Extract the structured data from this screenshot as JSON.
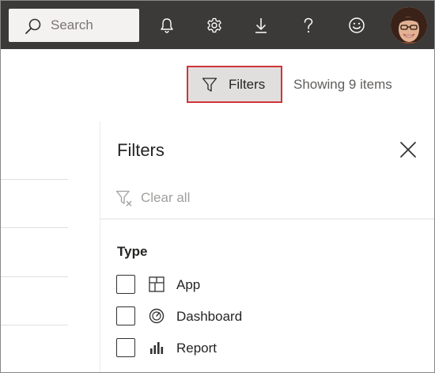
{
  "topbar": {
    "search": {
      "placeholder": "Search",
      "icon": "search-icon"
    },
    "actions": [
      {
        "name": "notifications",
        "icon": "bell-icon"
      },
      {
        "name": "settings",
        "icon": "gear-icon"
      },
      {
        "name": "download",
        "icon": "download-icon"
      },
      {
        "name": "help",
        "icon": "help-icon"
      },
      {
        "name": "feedback",
        "icon": "smiley-icon"
      }
    ],
    "avatar": {
      "icon": "user-avatar"
    },
    "colors": {
      "background": "#3b3a39",
      "icon": "#ffffff"
    }
  },
  "toolbar": {
    "filters_label": "Filters",
    "filters_icon": "funnel-icon",
    "showing_text": "Showing 9 items",
    "highlight_color": "#d13438"
  },
  "filter_pane": {
    "title": "Filters",
    "close_icon": "close-icon",
    "clear_all_label": "Clear all",
    "clear_all_icon": "clear-filter-icon",
    "sections": [
      {
        "title": "Type",
        "options": [
          {
            "label": "App",
            "icon": "app-icon",
            "checked": false
          },
          {
            "label": "Dashboard",
            "icon": "dashboard-icon",
            "checked": false
          },
          {
            "label": "Report",
            "icon": "report-icon",
            "checked": false
          }
        ]
      }
    ]
  }
}
